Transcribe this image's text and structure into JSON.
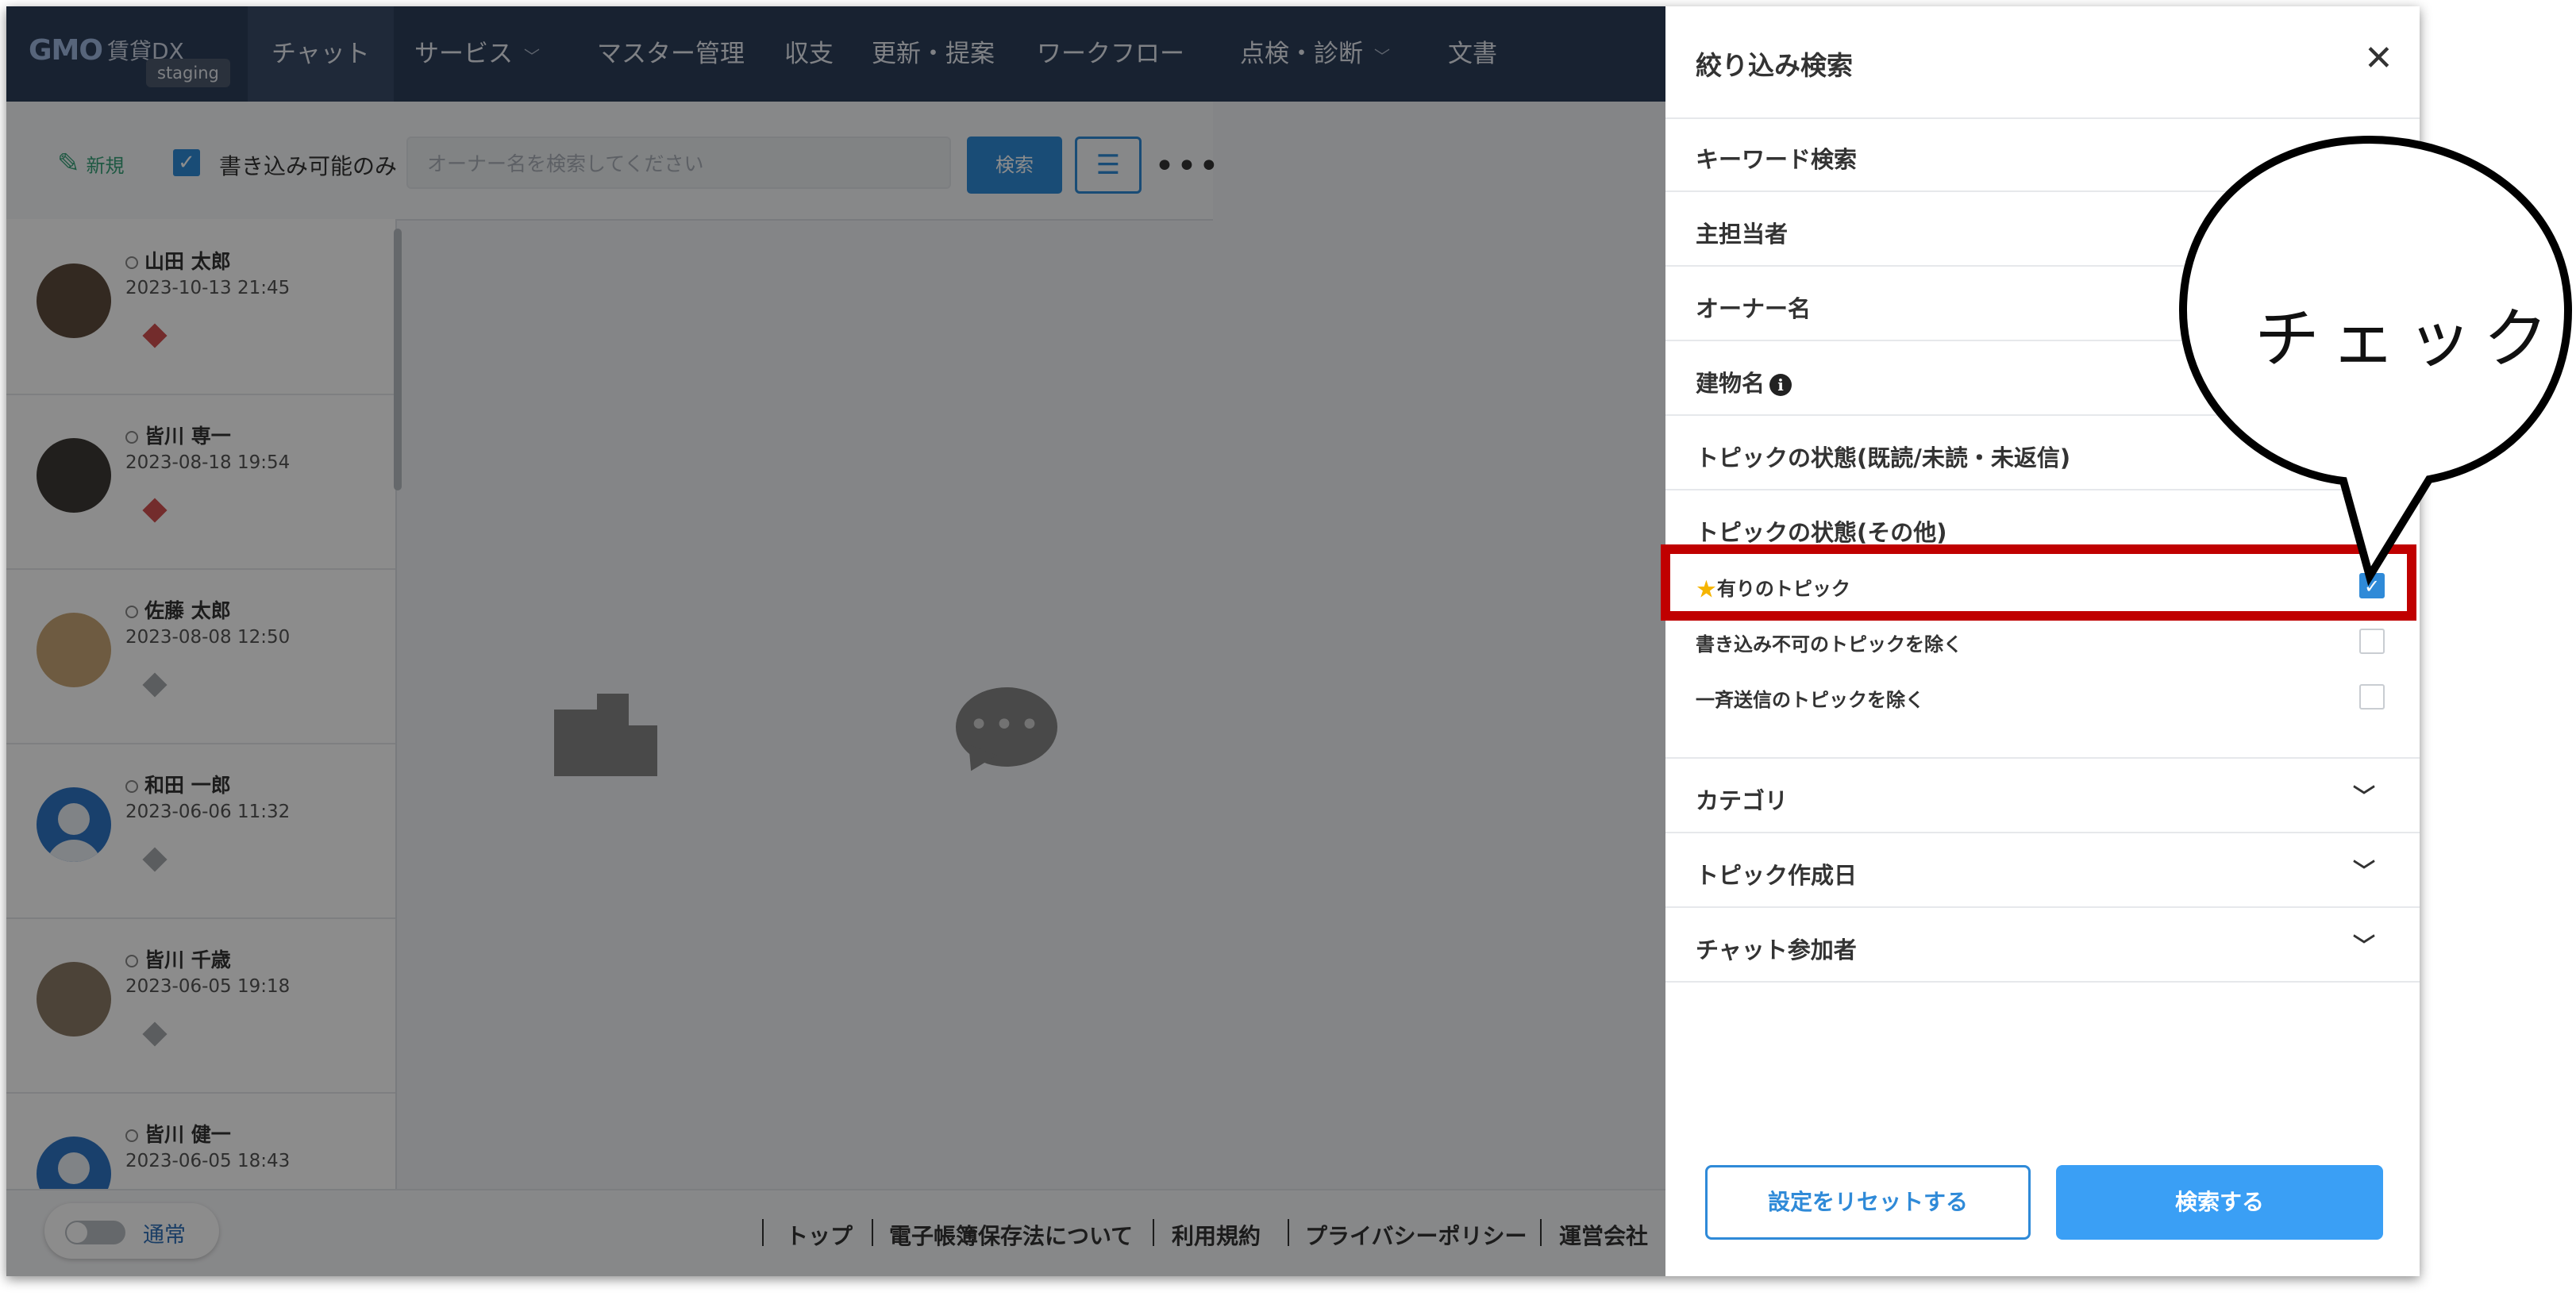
{
  "nav": {
    "logo_gmo": "GMO",
    "logo_brand": "賃貸DX",
    "env_badge": "staging",
    "items": [
      {
        "label": "チャット",
        "dropdown": false
      },
      {
        "label": "サービス",
        "dropdown": true
      },
      {
        "label": "マスター管理",
        "dropdown": false
      },
      {
        "label": "収支",
        "dropdown": false
      },
      {
        "label": "更新・提案",
        "dropdown": false
      },
      {
        "label": "ワークフロー",
        "dropdown": false
      },
      {
        "label": "点検・診断",
        "dropdown": true
      },
      {
        "label": "文書",
        "dropdown": false
      }
    ]
  },
  "toolbar": {
    "new_label": "新規",
    "writable_only_label": "書き込み可能のみ",
    "writable_only_checked": true,
    "search_placeholder": "オーナー名を検索してください",
    "search_button": "検索"
  },
  "users": [
    {
      "name": "山田 太郎",
      "date": "2023-10-13 21:45",
      "avatar": "cat1",
      "badge": "red"
    },
    {
      "name": "皆川 専一",
      "date": "2023-08-18 19:54",
      "avatar": "cat2",
      "badge": "red"
    },
    {
      "name": "佐藤 太郎",
      "date": "2023-08-08 12:50",
      "avatar": "dog",
      "badge": "gray"
    },
    {
      "name": "和田 一郎",
      "date": "2023-06-06 11:32",
      "avatar": "blue",
      "badge": "gray"
    },
    {
      "name": "皆川 千歳",
      "date": "2023-06-05 19:18",
      "avatar": "cat3",
      "badge": "gray"
    },
    {
      "name": "皆川 健一",
      "date": "2023-06-05 18:43",
      "avatar": "blue",
      "badge": "gray"
    }
  ],
  "footer": {
    "mode_label": "通常",
    "links": [
      "トップ",
      "電子帳簿保存法について",
      "利用規約",
      "プライバシーポリシー",
      "運営会社"
    ]
  },
  "filter_panel": {
    "title": "絞り込み検索",
    "sections": {
      "keyword": "キーワード検索",
      "main_owner": "主担当者",
      "owner_name": "オーナー名",
      "building_name": "建物名",
      "topic_status_read": "トピックの状態(既読/未読・未返信)",
      "topic_status_other": "トピックの状態(その他)",
      "category": "カテゴリ",
      "topic_created": "トピック作成日",
      "chat_members": "チャット参加者"
    },
    "options": [
      {
        "label": "有りのトピック",
        "checked": true,
        "star": true
      },
      {
        "label": "書き込み不可のトピックを除く",
        "checked": false,
        "star": false
      },
      {
        "label": "一斉送信のトピックを除く",
        "checked": false,
        "star": false
      }
    ],
    "reset_button": "設定をリセットする",
    "search_button": "検索する"
  },
  "annotation": {
    "callout_text": "チェック",
    "highlight_color": "#c00000"
  },
  "colors": {
    "nav_bg": "#2d3e5a",
    "accent": "#2f8ad8",
    "primary_button": "#3a9ff5"
  }
}
